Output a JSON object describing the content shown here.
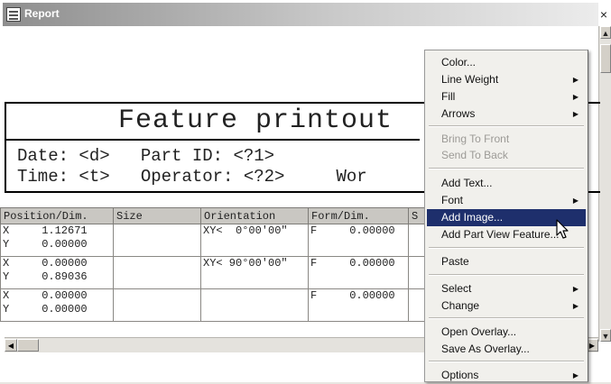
{
  "window": {
    "title": "Report",
    "close_label": "×"
  },
  "report": {
    "headline": "Feature printout",
    "line1": "Date: <d>   Part ID: <?1>",
    "line2": "Time: <t>   Operator: <?2>     Wor"
  },
  "table": {
    "headers": [
      "Position/Dim.",
      "Size",
      "Orientation",
      "Form/Dim.",
      "S"
    ],
    "rows": [
      {
        "pos": "X     1.12671\nY     0.00000",
        "size": "",
        "orient": "XY<  0°00'00\"",
        "form": "F     0.00000",
        "s": ""
      },
      {
        "pos": "X     0.00000\nY     0.89036",
        "size": "",
        "orient": "XY< 90°00'00\"",
        "form": "F     0.00000",
        "s": ""
      },
      {
        "pos": "X     0.00000\nY     0.00000",
        "size": "",
        "orient": "",
        "form": "F     0.00000",
        "s": ""
      }
    ]
  },
  "context_menu": {
    "items": [
      {
        "label": "Color...",
        "submenu": false,
        "disabled": false
      },
      {
        "label": "Line Weight",
        "submenu": true,
        "disabled": false
      },
      {
        "label": "Fill",
        "submenu": true,
        "disabled": false
      },
      {
        "label": "Arrows",
        "submenu": true,
        "disabled": false
      },
      {
        "label": "Bring To Front",
        "submenu": false,
        "disabled": true
      },
      {
        "label": "Send To Back",
        "submenu": false,
        "disabled": true
      },
      {
        "label": "Add Text...",
        "submenu": false,
        "disabled": false
      },
      {
        "label": "Font",
        "submenu": true,
        "disabled": false
      },
      {
        "label": "Add Image...",
        "submenu": false,
        "disabled": false,
        "highlighted": true
      },
      {
        "label": "Add Part View Feature...",
        "submenu": false,
        "disabled": false
      },
      {
        "label": "Paste",
        "submenu": false,
        "disabled": false
      },
      {
        "label": "Select",
        "submenu": true,
        "disabled": false
      },
      {
        "label": "Change",
        "submenu": true,
        "disabled": false
      },
      {
        "label": "Open Overlay...",
        "submenu": false,
        "disabled": false
      },
      {
        "label": "Save As Overlay...",
        "submenu": false,
        "disabled": false
      },
      {
        "label": "Options",
        "submenu": true,
        "disabled": false
      }
    ],
    "submenu_glyph": "▶"
  },
  "colors": {
    "highlight": "#1e2f6c",
    "titlebar_start": "#8e8e8e",
    "menu_bg": "#f1f0ec"
  }
}
